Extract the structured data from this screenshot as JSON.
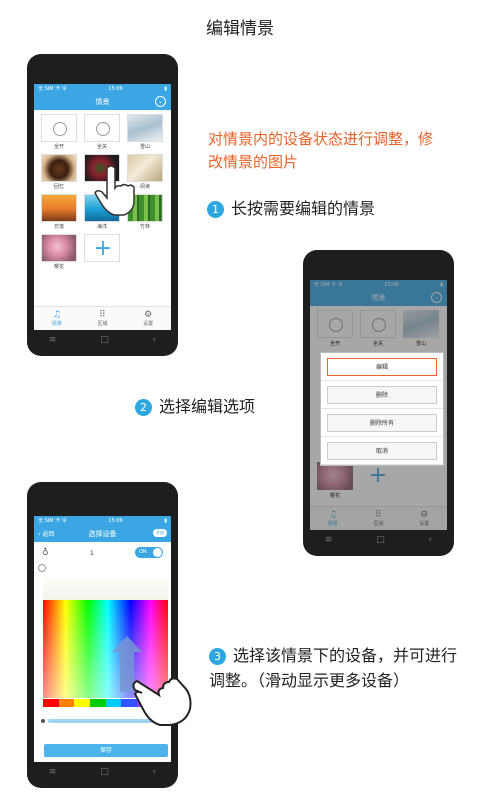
{
  "header": {
    "title": "编辑情景"
  },
  "phone1": {
    "status": {
      "carrier": "无 SIM 卡 令",
      "time": "15:06"
    },
    "nav_title": "情景",
    "scenes": [
      {
        "label": "全开",
        "image": "bulb-icon"
      },
      {
        "label": "全关",
        "image": "bulb-icon"
      },
      {
        "label": "雪山",
        "image": "snow-mountain"
      },
      {
        "label": "回忆",
        "image": "coffee"
      },
      {
        "label": "",
        "image": "party"
      },
      {
        "label": "阅读",
        "image": "book"
      },
      {
        "label": "日落",
        "image": "sunset"
      },
      {
        "label": "海洋",
        "image": "ocean"
      },
      {
        "label": "竹林",
        "image": "bamboo"
      },
      {
        "label": "樱花",
        "image": "flower"
      }
    ],
    "add_label": "+",
    "tabs": [
      "情景",
      "区域",
      "设置"
    ],
    "softkeys": [
      "≡",
      "□",
      "‹"
    ]
  },
  "annotation": {
    "description": "对情景内的设备状态进行调整，修改情景的图片"
  },
  "steps": {
    "step1": {
      "num": "1",
      "text": "长按需要编辑的情景"
    },
    "step2": {
      "num": "2",
      "text": "选择编辑选项"
    },
    "step3": {
      "num": "3",
      "text": "选择该情景下的设备，并可进行调整。（滑动显示更多设备）"
    }
  },
  "phone2": {
    "status": {
      "carrier": "无 SIM 卡 令",
      "time": "15:06"
    },
    "nav_title": "情景",
    "bg_labels": [
      "全开",
      "全关",
      "雪山",
      "樱花"
    ],
    "menu": [
      "编辑",
      "删除",
      "删除所有",
      "取消"
    ],
    "tabs": [
      "情景",
      "区域",
      "设置"
    ],
    "softkeys": [
      "≡",
      "□",
      "‹"
    ]
  },
  "phone3": {
    "status": {
      "carrier": "无 SIM 卡 令",
      "time": "15:06"
    },
    "back_label": "返回",
    "nav_title": "选择设备",
    "toggle_top": "开启",
    "device_num": "1",
    "device_toggle": "ON",
    "swatch_colors": [
      "#ff0000",
      "#ff8000",
      "#ffff00",
      "#00cc00",
      "#00ccff",
      "#3355ff",
      "#9933ff",
      "#ffffff"
    ],
    "save_label": "保存",
    "softkeys": [
      "≡",
      "□",
      "‹"
    ]
  },
  "colors": {
    "accent": "#3aa7e4",
    "highlight": "#e8622a",
    "step_badge": "#2ea7e0"
  }
}
